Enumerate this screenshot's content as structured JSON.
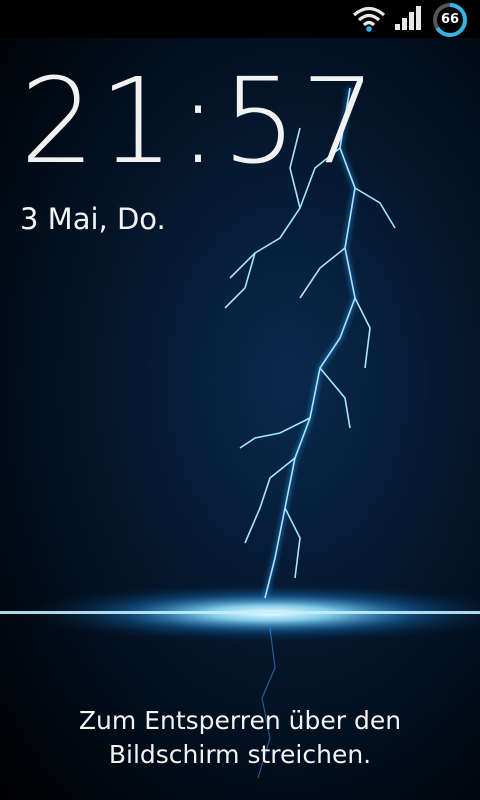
{
  "status_bar": {
    "icons": [
      "wifi-icon",
      "signal-icon",
      "battery-icon"
    ],
    "battery_level": "66"
  },
  "lockscreen": {
    "time": "21:57",
    "date": "3 Mai, Do.",
    "unlock_hint_line1": "Zum Entsperren über den",
    "unlock_hint_line2": "Bildschirm streichen."
  },
  "colors": {
    "accent": "#33b5e5",
    "wallpaper_dark": "#010811",
    "lightning": "#6fd0ff"
  }
}
